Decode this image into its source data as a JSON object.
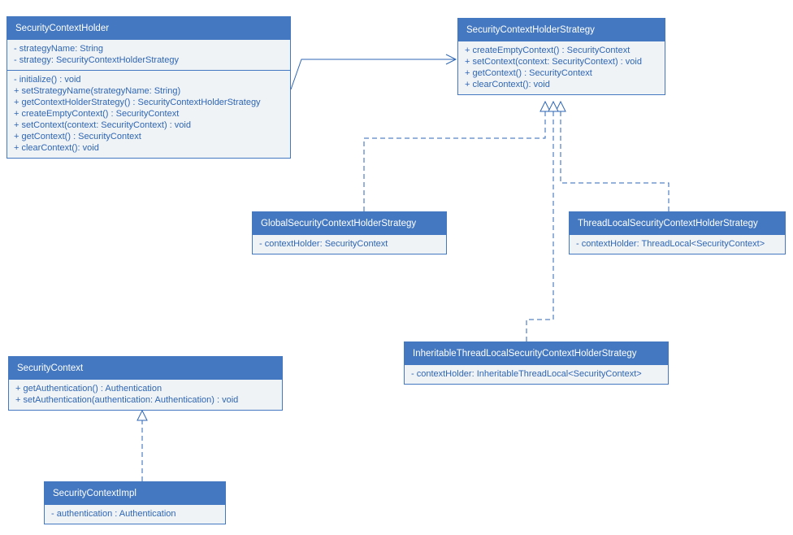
{
  "classes": {
    "securityContextHolder": {
      "title": "SecurityContextHolder",
      "attrs": [
        "- strategyName: String",
        "- strategy: SecurityContextHolderStrategy"
      ],
      "ops": [
        "- initialize() : void",
        "+ setStrategyName(strategyName: String)",
        "+ getContextHolderStrategy() : SecurityContextHolderStrategy",
        "+ createEmptyContext() : SecurityContext",
        "+ setContext(context: SecurityContext) : void",
        "+ getContext() : SecurityContext",
        "+ clearContext(): void"
      ]
    },
    "securityContextHolderStrategy": {
      "title": "SecurityContextHolderStrategy",
      "ops": [
        "+ createEmptyContext() : SecurityContext",
        "+ setContext(context: SecurityContext) : void",
        "+ getContext() : SecurityContext",
        "+ clearContext(): void"
      ]
    },
    "globalStrategy": {
      "title": "GlobalSecurityContextHolderStrategy",
      "attrs": [
        "- contextHolder: SecurityContext"
      ]
    },
    "threadLocalStrategy": {
      "title": "ThreadLocalSecurityContextHolderStrategy",
      "attrs": [
        "- contextHolder: ThreadLocal<SecurityContext>"
      ]
    },
    "inheritableStrategy": {
      "title": "InheritableThreadLocalSecurityContextHolderStrategy",
      "attrs": [
        "- contextHolder: InheritableThreadLocal<SecurityContext>"
      ]
    },
    "securityContext": {
      "title": "SecurityContext",
      "ops": [
        "+ getAuthentication() : Authentication",
        "+ setAuthentication(authentication: Authentication) : void"
      ]
    },
    "securityContextImpl": {
      "title": "SecurityContextImpl",
      "attrs": [
        "- authentication : Authentication"
      ]
    }
  }
}
